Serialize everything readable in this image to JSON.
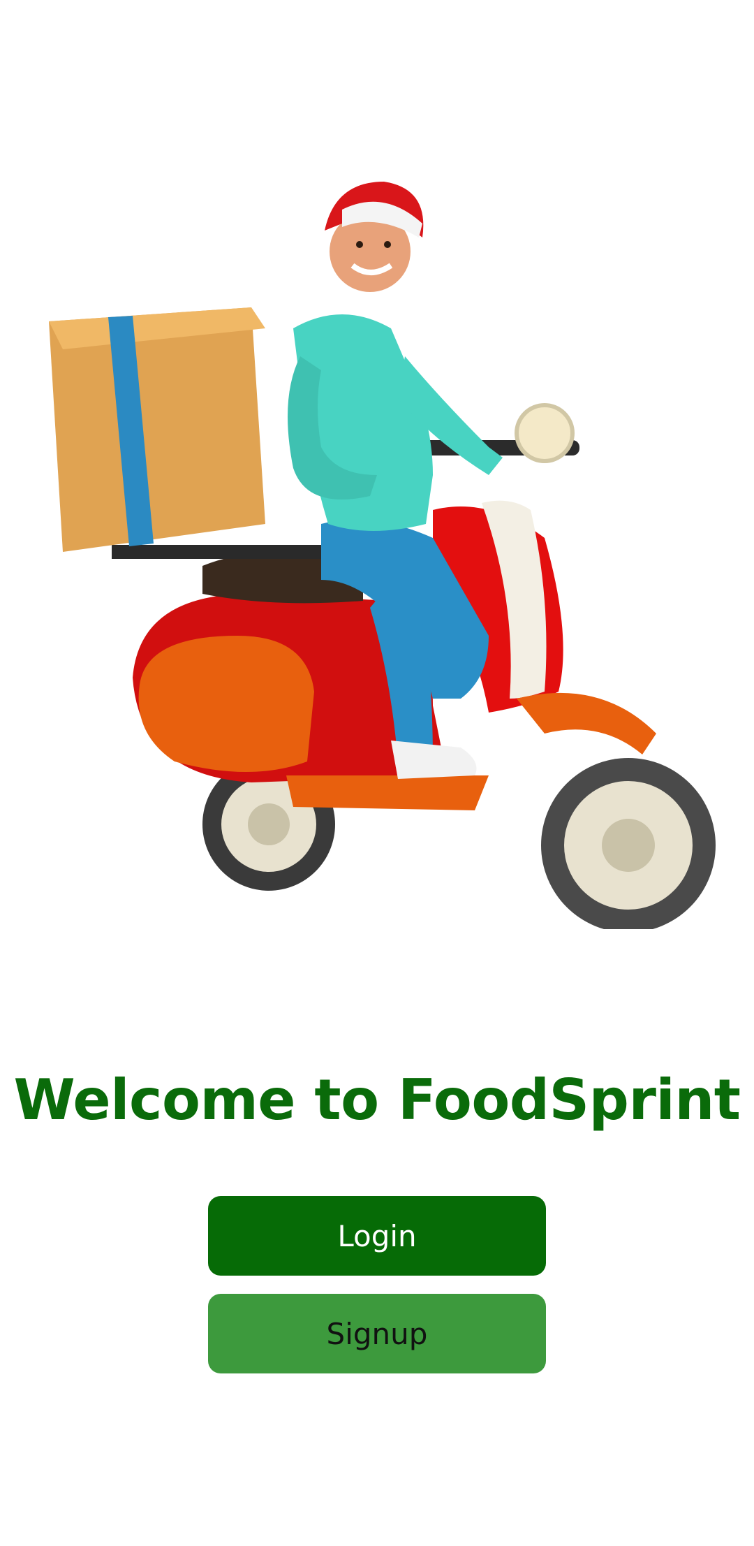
{
  "welcome": {
    "title": "Welcome to FoodSprint"
  },
  "actions": {
    "login_label": "Login",
    "signup_label": "Signup"
  },
  "illustration": {
    "icon": "delivery-scooter-rider-illustration"
  },
  "colors": {
    "title": "#0a6b0a",
    "login_bg": "#066b06",
    "signup_bg": "#3d9a3d",
    "background": "#ffffff"
  }
}
